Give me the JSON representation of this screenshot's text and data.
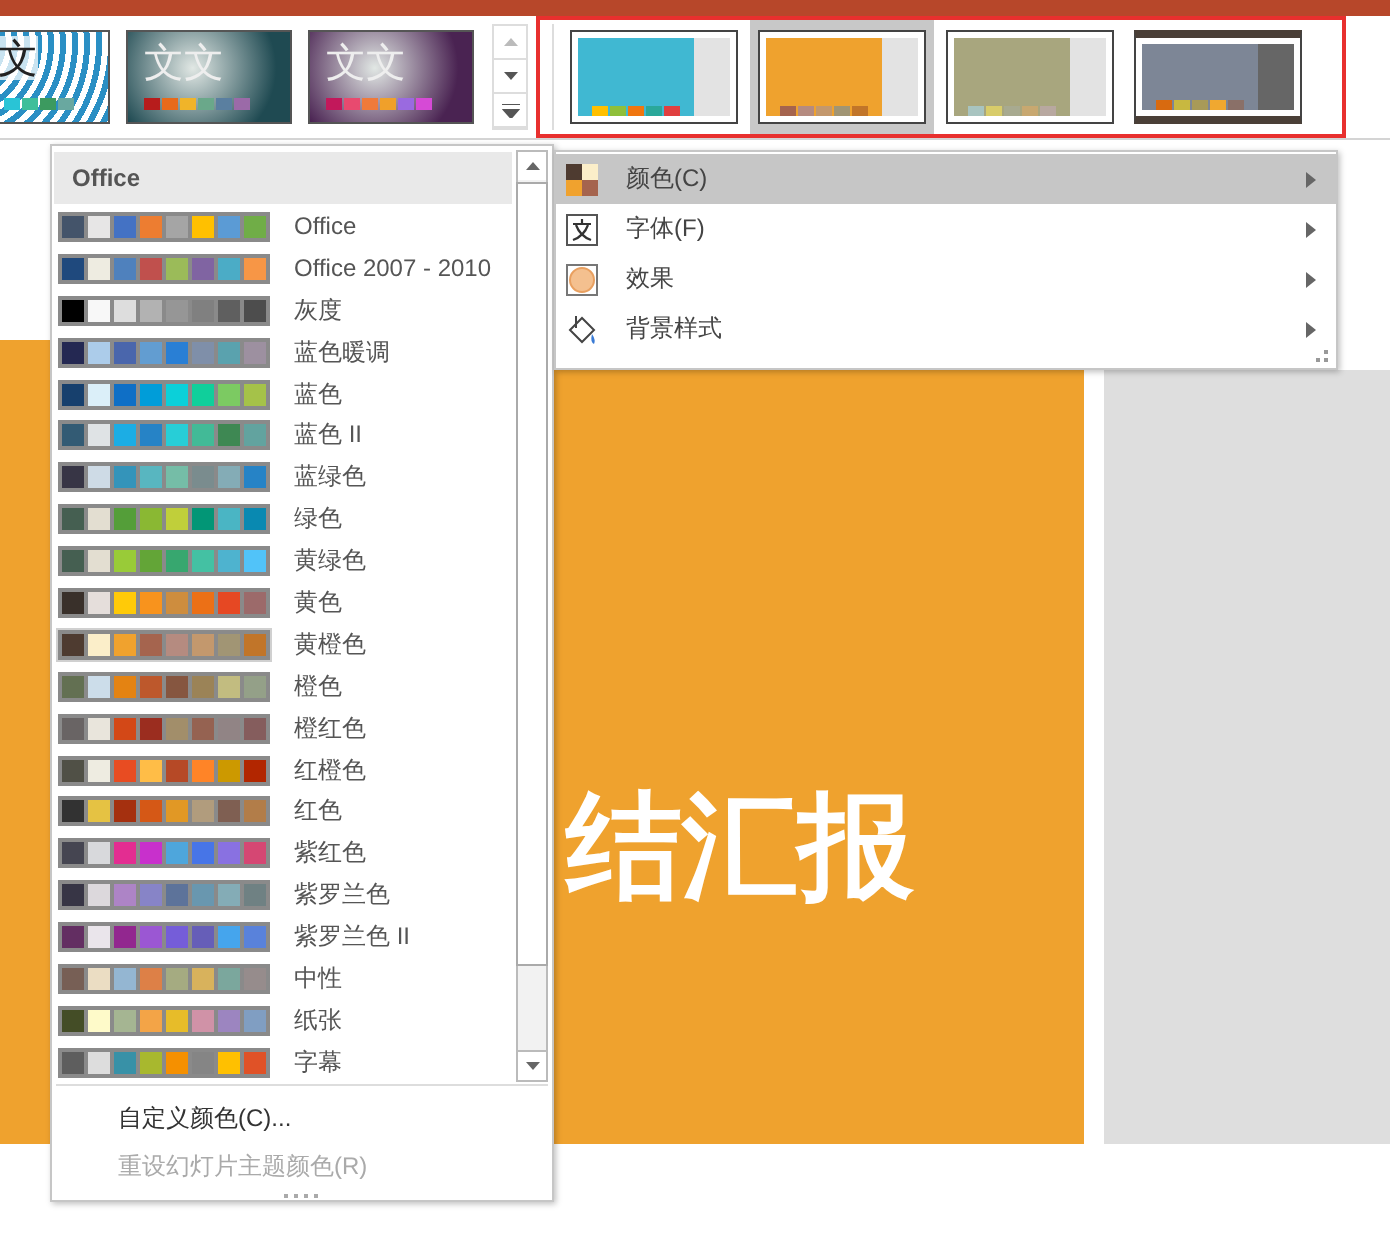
{
  "theme_gallery": [
    {
      "kind": "pattern",
      "text": "文",
      "color": "#2a8fc4",
      "accents": [
        {
          "color": "#29c4d6"
        },
        {
          "color": "#3fbf9a"
        },
        {
          "color": "#3c9a5f"
        },
        {
          "color": "#69a8a0"
        }
      ]
    },
    {
      "kind": "gradient",
      "text": "文文",
      "color": "#1f4a52",
      "accents": [
        {
          "color": "#b71c1c"
        },
        {
          "color": "#e86a1a"
        },
        {
          "color": "#f0b429"
        },
        {
          "color": "#6aa88a"
        },
        {
          "color": "#5a7fa0"
        },
        {
          "color": "#9b6aa8"
        }
      ]
    },
    {
      "kind": "gradient",
      "text": "文文",
      "color": "#4a2352",
      "accents": [
        {
          "color": "#c2185b"
        },
        {
          "color": "#e84a6f"
        },
        {
          "color": "#f07a3a"
        },
        {
          "color": "#f0a02a"
        },
        {
          "color": "#9a6ae0"
        },
        {
          "color": "#d64ad6"
        }
      ]
    }
  ],
  "variant_gallery": [
    {
      "kind": "plain",
      "color": "#40b8d2",
      "selected": false,
      "accents": [
        {
          "color": "#ffc000"
        },
        {
          "color": "#8fbf3a"
        },
        {
          "color": "#f0760f"
        },
        {
          "color": "#2aa89a"
        },
        {
          "color": "#e04040"
        }
      ]
    },
    {
      "kind": "plain",
      "color": "#efa22e",
      "selected": true,
      "accents": [
        {
          "color": "#a5644e"
        },
        {
          "color": "#b58b80"
        },
        {
          "color": "#c3986d"
        },
        {
          "color": "#a19574"
        },
        {
          "color": "#c17529"
        }
      ]
    },
    {
      "kind": "plain",
      "color": "#a8a67e",
      "selected": false,
      "accents": [
        {
          "color": "#a8c4c0"
        },
        {
          "color": "#d8cc6a"
        },
        {
          "color": "#a8aa90"
        },
        {
          "color": "#c8a870"
        },
        {
          "color": "#b8a8a0"
        }
      ]
    },
    {
      "kind": "framed",
      "color": "#7d8696",
      "selected": false,
      "accents": [
        {
          "color": "#d86a10"
        },
        {
          "color": "#c8b840"
        },
        {
          "color": "#a89a58"
        },
        {
          "color": "#f0a830"
        },
        {
          "color": "#8a7068"
        }
      ]
    }
  ],
  "colors_dropdown": {
    "heading": "Office",
    "palettes": [
      {
        "name": "Office",
        "selected": false,
        "colors": [
          {
            "color": "#44546a"
          },
          {
            "color": "#e7e6e6"
          },
          {
            "color": "#4472c4"
          },
          {
            "color": "#ed7d31"
          },
          {
            "color": "#a5a5a5"
          },
          {
            "color": "#ffc000"
          },
          {
            "color": "#5b9bd5"
          },
          {
            "color": "#70ad47"
          }
        ]
      },
      {
        "name": "Office 2007 - 2010",
        "selected": false,
        "colors": [
          {
            "color": "#1f497d"
          },
          {
            "color": "#eeece1"
          },
          {
            "color": "#4f81bd"
          },
          {
            "color": "#c0504d"
          },
          {
            "color": "#9bbb59"
          },
          {
            "color": "#8064a2"
          },
          {
            "color": "#4bacc6"
          },
          {
            "color": "#f79646"
          }
        ]
      },
      {
        "name": "灰度",
        "selected": false,
        "colors": [
          {
            "color": "#000000"
          },
          {
            "color": "#f8f8f8"
          },
          {
            "color": "#dddddd"
          },
          {
            "color": "#b2b2b2"
          },
          {
            "color": "#969696"
          },
          {
            "color": "#808080"
          },
          {
            "color": "#5f5f5f"
          },
          {
            "color": "#4d4d4d"
          }
        ]
      },
      {
        "name": "蓝色暖调",
        "selected": false,
        "colors": [
          {
            "color": "#242852"
          },
          {
            "color": "#acccea"
          },
          {
            "color": "#4a66ac"
          },
          {
            "color": "#629dd1"
          },
          {
            "color": "#297fd5"
          },
          {
            "color": "#7f8fa9"
          },
          {
            "color": "#5aa2ae"
          },
          {
            "color": "#9d90a0"
          }
        ]
      },
      {
        "name": "蓝色",
        "selected": false,
        "colors": [
          {
            "color": "#17406d"
          },
          {
            "color": "#dbeff9"
          },
          {
            "color": "#0f6fc6"
          },
          {
            "color": "#009dd9"
          },
          {
            "color": "#0bd0d9"
          },
          {
            "color": "#10cf9b"
          },
          {
            "color": "#7cca62"
          },
          {
            "color": "#a5c249"
          }
        ]
      },
      {
        "name": "蓝色 II",
        "selected": false,
        "colors": [
          {
            "color": "#335b74"
          },
          {
            "color": "#dfe3e5"
          },
          {
            "color": "#1cade4"
          },
          {
            "color": "#2683c6"
          },
          {
            "color": "#27ced7"
          },
          {
            "color": "#42ba97"
          },
          {
            "color": "#3e8853"
          },
          {
            "color": "#62a39f"
          }
        ]
      },
      {
        "name": "蓝绿色",
        "selected": false,
        "colors": [
          {
            "color": "#373545"
          },
          {
            "color": "#cedbe6"
          },
          {
            "color": "#3494ba"
          },
          {
            "color": "#58b6c0"
          },
          {
            "color": "#75bda7"
          },
          {
            "color": "#7a8c8e"
          },
          {
            "color": "#84acb6"
          },
          {
            "color": "#2683c6"
          }
        ]
      },
      {
        "name": "绿色",
        "selected": false,
        "colors": [
          {
            "color": "#455f51"
          },
          {
            "color": "#e3ded1"
          },
          {
            "color": "#549e39"
          },
          {
            "color": "#8ab833"
          },
          {
            "color": "#c0cf3a"
          },
          {
            "color": "#029676"
          },
          {
            "color": "#4ab5c4"
          },
          {
            "color": "#0989b1"
          }
        ]
      },
      {
        "name": "黄绿色",
        "selected": false,
        "colors": [
          {
            "color": "#455f51"
          },
          {
            "color": "#e3ded1"
          },
          {
            "color": "#99cb38"
          },
          {
            "color": "#63a537"
          },
          {
            "color": "#37a76f"
          },
          {
            "color": "#44c1a3"
          },
          {
            "color": "#4eb3cf"
          },
          {
            "color": "#51c3f9"
          }
        ]
      },
      {
        "name": "黄色",
        "selected": false,
        "colors": [
          {
            "color": "#39302a"
          },
          {
            "color": "#e5dedb"
          },
          {
            "color": "#ffca08"
          },
          {
            "color": "#f8931d"
          },
          {
            "color": "#ce8d3e"
          },
          {
            "color": "#ec7016"
          },
          {
            "color": "#e64823"
          },
          {
            "color": "#9c6a6a"
          }
        ]
      },
      {
        "name": "黄橙色",
        "selected": true,
        "colors": [
          {
            "color": "#4e3b30"
          },
          {
            "color": "#fbeec9"
          },
          {
            "color": "#f0a22e"
          },
          {
            "color": "#a5644e"
          },
          {
            "color": "#b58b80"
          },
          {
            "color": "#c3986d"
          },
          {
            "color": "#a19574"
          },
          {
            "color": "#c17529"
          }
        ]
      },
      {
        "name": "橙色",
        "selected": false,
        "colors": [
          {
            "color": "#637052"
          },
          {
            "color": "#ccddea"
          },
          {
            "color": "#e48312"
          },
          {
            "color": "#bd582c"
          },
          {
            "color": "#865640"
          },
          {
            "color": "#9b8357"
          },
          {
            "color": "#c2bc80"
          },
          {
            "color": "#94a088"
          }
        ]
      },
      {
        "name": "橙红色",
        "selected": false,
        "colors": [
          {
            "color": "#696464"
          },
          {
            "color": "#e9e5dc"
          },
          {
            "color": "#d34817"
          },
          {
            "color": "#9b2d1f"
          },
          {
            "color": "#a28e6a"
          },
          {
            "color": "#956251"
          },
          {
            "color": "#918485"
          },
          {
            "color": "#855d5d"
          }
        ]
      },
      {
        "name": "红橙色",
        "selected": false,
        "colors": [
          {
            "color": "#505046"
          },
          {
            "color": "#eeece1"
          },
          {
            "color": "#e84c22"
          },
          {
            "color": "#ffbd47"
          },
          {
            "color": "#b64926"
          },
          {
            "color": "#ff8427"
          },
          {
            "color": "#cc9900"
          },
          {
            "color": "#b22600"
          }
        ]
      },
      {
        "name": "红色",
        "selected": false,
        "colors": [
          {
            "color": "#323232"
          },
          {
            "color": "#e5c243"
          },
          {
            "color": "#a5300f"
          },
          {
            "color": "#d55816"
          },
          {
            "color": "#e19825"
          },
          {
            "color": "#b19c7d"
          },
          {
            "color": "#7f5f52"
          },
          {
            "color": "#b27d49"
          }
        ]
      },
      {
        "name": "紫红色",
        "selected": false,
        "colors": [
          {
            "color": "#454551"
          },
          {
            "color": "#d8d9dc"
          },
          {
            "color": "#e32d91"
          },
          {
            "color": "#c830cc"
          },
          {
            "color": "#4ea6dc"
          },
          {
            "color": "#4775e7"
          },
          {
            "color": "#8971e1"
          },
          {
            "color": "#d54773"
          }
        ]
      },
      {
        "name": "紫罗兰色",
        "selected": false,
        "colors": [
          {
            "color": "#373545"
          },
          {
            "color": "#dcd8dc"
          },
          {
            "color": "#ad84c6"
          },
          {
            "color": "#8784c7"
          },
          {
            "color": "#5d739a"
          },
          {
            "color": "#6997af"
          },
          {
            "color": "#84acb6"
          },
          {
            "color": "#6f8183"
          }
        ]
      },
      {
        "name": "紫罗兰色 II",
        "selected": false,
        "colors": [
          {
            "color": "#632e62"
          },
          {
            "color": "#eae5eb"
          },
          {
            "color": "#92278f"
          },
          {
            "color": "#9b57d3"
          },
          {
            "color": "#755dd9"
          },
          {
            "color": "#665eb8"
          },
          {
            "color": "#45a5ed"
          },
          {
            "color": "#5982db"
          }
        ]
      },
      {
        "name": "中性",
        "selected": false,
        "colors": [
          {
            "color": "#775f55"
          },
          {
            "color": "#ebddc3"
          },
          {
            "color": "#94b6d2"
          },
          {
            "color": "#dd8047"
          },
          {
            "color": "#a5ab81"
          },
          {
            "color": "#d8b25c"
          },
          {
            "color": "#7ba79d"
          },
          {
            "color": "#968c8c"
          }
        ]
      },
      {
        "name": "纸张",
        "selected": false,
        "colors": [
          {
            "color": "#444d26"
          },
          {
            "color": "#fefac9"
          },
          {
            "color": "#a5b592"
          },
          {
            "color": "#f3a447"
          },
          {
            "color": "#e7bc29"
          },
          {
            "color": "#d092a7"
          },
          {
            "color": "#9c85c0"
          },
          {
            "color": "#809ec2"
          }
        ]
      },
      {
        "name": "字幕",
        "selected": false,
        "colors": [
          {
            "color": "#5e5e5e"
          },
          {
            "color": "#dddddd"
          },
          {
            "color": "#3891a7"
          },
          {
            "color": "#a8b82e"
          },
          {
            "color": "#f59000"
          },
          {
            "color": "#858585"
          },
          {
            "color": "#ffc000"
          },
          {
            "color": "#e05227"
          }
        ]
      }
    ],
    "footer": [
      {
        "label": "自定义颜色(C)...",
        "disabled": false
      },
      {
        "label": "重设幻灯片主题颜色(R)",
        "disabled": true
      }
    ]
  },
  "variants_menu": [
    {
      "kind": "colors",
      "label": "颜色(C)",
      "selected": true
    },
    {
      "kind": "fonts",
      "label": "字体(F)",
      "selected": false
    },
    {
      "kind": "effects",
      "label": "效果",
      "selected": false
    },
    {
      "kind": "background",
      "label": "背景样式",
      "selected": false
    }
  ],
  "slide": {
    "title": "结汇报"
  }
}
